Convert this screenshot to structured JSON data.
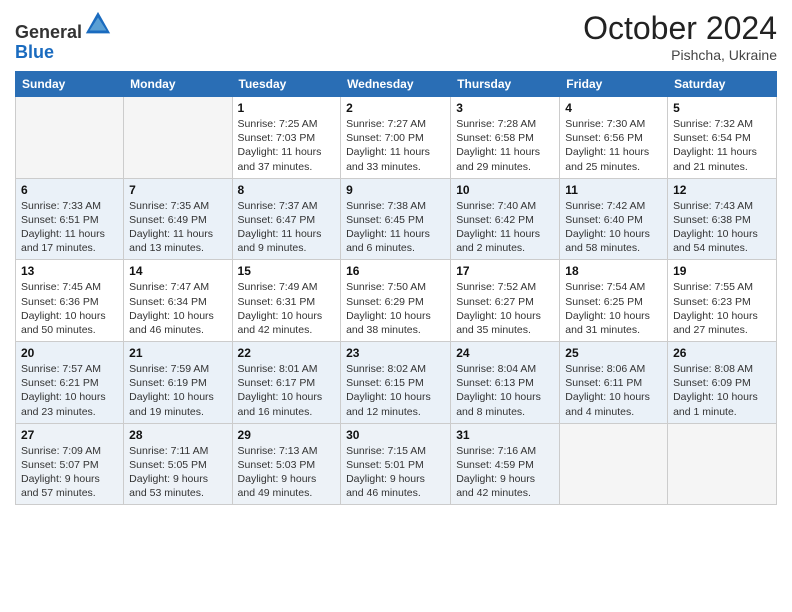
{
  "header": {
    "logo_general": "General",
    "logo_blue": "Blue",
    "month": "October 2024",
    "location": "Pishcha, Ukraine"
  },
  "weekdays": [
    "Sunday",
    "Monday",
    "Tuesday",
    "Wednesday",
    "Thursday",
    "Friday",
    "Saturday"
  ],
  "weeks": [
    [
      {
        "day": "",
        "info": ""
      },
      {
        "day": "",
        "info": ""
      },
      {
        "day": "1",
        "info": "Sunrise: 7:25 AM\nSunset: 7:03 PM\nDaylight: 11 hours and 37 minutes."
      },
      {
        "day": "2",
        "info": "Sunrise: 7:27 AM\nSunset: 7:00 PM\nDaylight: 11 hours and 33 minutes."
      },
      {
        "day": "3",
        "info": "Sunrise: 7:28 AM\nSunset: 6:58 PM\nDaylight: 11 hours and 29 minutes."
      },
      {
        "day": "4",
        "info": "Sunrise: 7:30 AM\nSunset: 6:56 PM\nDaylight: 11 hours and 25 minutes."
      },
      {
        "day": "5",
        "info": "Sunrise: 7:32 AM\nSunset: 6:54 PM\nDaylight: 11 hours and 21 minutes."
      }
    ],
    [
      {
        "day": "6",
        "info": "Sunrise: 7:33 AM\nSunset: 6:51 PM\nDaylight: 11 hours and 17 minutes."
      },
      {
        "day": "7",
        "info": "Sunrise: 7:35 AM\nSunset: 6:49 PM\nDaylight: 11 hours and 13 minutes."
      },
      {
        "day": "8",
        "info": "Sunrise: 7:37 AM\nSunset: 6:47 PM\nDaylight: 11 hours and 9 minutes."
      },
      {
        "day": "9",
        "info": "Sunrise: 7:38 AM\nSunset: 6:45 PM\nDaylight: 11 hours and 6 minutes."
      },
      {
        "day": "10",
        "info": "Sunrise: 7:40 AM\nSunset: 6:42 PM\nDaylight: 11 hours and 2 minutes."
      },
      {
        "day": "11",
        "info": "Sunrise: 7:42 AM\nSunset: 6:40 PM\nDaylight: 10 hours and 58 minutes."
      },
      {
        "day": "12",
        "info": "Sunrise: 7:43 AM\nSunset: 6:38 PM\nDaylight: 10 hours and 54 minutes."
      }
    ],
    [
      {
        "day": "13",
        "info": "Sunrise: 7:45 AM\nSunset: 6:36 PM\nDaylight: 10 hours and 50 minutes."
      },
      {
        "day": "14",
        "info": "Sunrise: 7:47 AM\nSunset: 6:34 PM\nDaylight: 10 hours and 46 minutes."
      },
      {
        "day": "15",
        "info": "Sunrise: 7:49 AM\nSunset: 6:31 PM\nDaylight: 10 hours and 42 minutes."
      },
      {
        "day": "16",
        "info": "Sunrise: 7:50 AM\nSunset: 6:29 PM\nDaylight: 10 hours and 38 minutes."
      },
      {
        "day": "17",
        "info": "Sunrise: 7:52 AM\nSunset: 6:27 PM\nDaylight: 10 hours and 35 minutes."
      },
      {
        "day": "18",
        "info": "Sunrise: 7:54 AM\nSunset: 6:25 PM\nDaylight: 10 hours and 31 minutes."
      },
      {
        "day": "19",
        "info": "Sunrise: 7:55 AM\nSunset: 6:23 PM\nDaylight: 10 hours and 27 minutes."
      }
    ],
    [
      {
        "day": "20",
        "info": "Sunrise: 7:57 AM\nSunset: 6:21 PM\nDaylight: 10 hours and 23 minutes."
      },
      {
        "day": "21",
        "info": "Sunrise: 7:59 AM\nSunset: 6:19 PM\nDaylight: 10 hours and 19 minutes."
      },
      {
        "day": "22",
        "info": "Sunrise: 8:01 AM\nSunset: 6:17 PM\nDaylight: 10 hours and 16 minutes."
      },
      {
        "day": "23",
        "info": "Sunrise: 8:02 AM\nSunset: 6:15 PM\nDaylight: 10 hours and 12 minutes."
      },
      {
        "day": "24",
        "info": "Sunrise: 8:04 AM\nSunset: 6:13 PM\nDaylight: 10 hours and 8 minutes."
      },
      {
        "day": "25",
        "info": "Sunrise: 8:06 AM\nSunset: 6:11 PM\nDaylight: 10 hours and 4 minutes."
      },
      {
        "day": "26",
        "info": "Sunrise: 8:08 AM\nSunset: 6:09 PM\nDaylight: 10 hours and 1 minute."
      }
    ],
    [
      {
        "day": "27",
        "info": "Sunrise: 7:09 AM\nSunset: 5:07 PM\nDaylight: 9 hours and 57 minutes."
      },
      {
        "day": "28",
        "info": "Sunrise: 7:11 AM\nSunset: 5:05 PM\nDaylight: 9 hours and 53 minutes."
      },
      {
        "day": "29",
        "info": "Sunrise: 7:13 AM\nSunset: 5:03 PM\nDaylight: 9 hours and 49 minutes."
      },
      {
        "day": "30",
        "info": "Sunrise: 7:15 AM\nSunset: 5:01 PM\nDaylight: 9 hours and 46 minutes."
      },
      {
        "day": "31",
        "info": "Sunrise: 7:16 AM\nSunset: 4:59 PM\nDaylight: 9 hours and 42 minutes."
      },
      {
        "day": "",
        "info": ""
      },
      {
        "day": "",
        "info": ""
      }
    ]
  ]
}
